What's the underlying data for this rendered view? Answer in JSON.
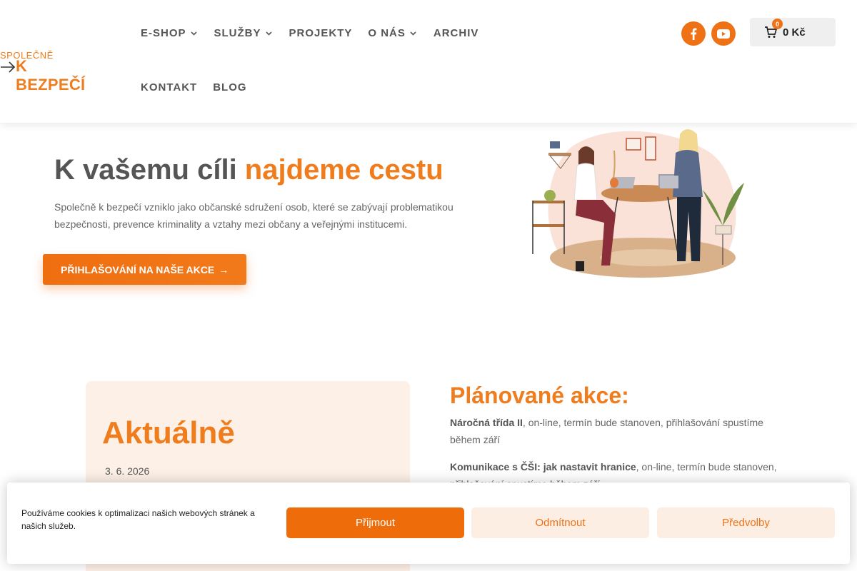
{
  "logo": {
    "line1": "SPOLEČNĚ",
    "line2": "K BEZPEČÍ",
    "color": "#ef7d1e"
  },
  "nav": {
    "row1": [
      {
        "label": "E-SHOP",
        "dropdown": true
      },
      {
        "label": "SLUŽBY",
        "dropdown": true
      },
      {
        "label": "PROJEKTY",
        "dropdown": false
      },
      {
        "label": "O NÁS",
        "dropdown": true
      },
      {
        "label": "ARCHIV",
        "dropdown": false
      }
    ],
    "row2": [
      {
        "label": "KONTAKT"
      },
      {
        "label": "BLOG"
      }
    ],
    "chevron": "⌄"
  },
  "social": {
    "facebook": "facebook-icon",
    "youtube": "youtube-icon"
  },
  "cart": {
    "count": "0",
    "total": "0 Kč",
    "icon": "cart-icon"
  },
  "hero": {
    "title_plain": "K vašemu cíli ",
    "title_accent": "najdeme cestu",
    "text": "Společně k bezpečí vzniklo jako občanské sdružení osob, které se zabývají problematikou bezpečnosti, prevence kriminality a vztahy mezi občany a veřejnými institucemi.",
    "cta_label": "PŘIHLAŠOVÁNÍ NA NAŠE AKCE",
    "cta_arrow": "→"
  },
  "news": {
    "title": "Aktuálně",
    "date": "3. 6. 2026"
  },
  "planned": {
    "title": "Plánované akce:",
    "events": [
      {
        "name": "Náročná třída II",
        "detail": ", on-line, termín bude stanoven, přihlašování spustíme během září"
      },
      {
        "name": "Komunikace s ČŠI: jak nastavit hranice",
        "detail": ", on-line, termín bude stanoven, přihlašování spustíme během září"
      }
    ]
  },
  "cookie": {
    "text": "Používáme cookies k optimalizaci našich webových stránek a našich služeb.",
    "accept": "Přijmout",
    "deny": "Odmítnout",
    "prefs": "Předvolby"
  },
  "colors": {
    "accent": "#ef7116",
    "news_bg": "#fdf0e6"
  }
}
